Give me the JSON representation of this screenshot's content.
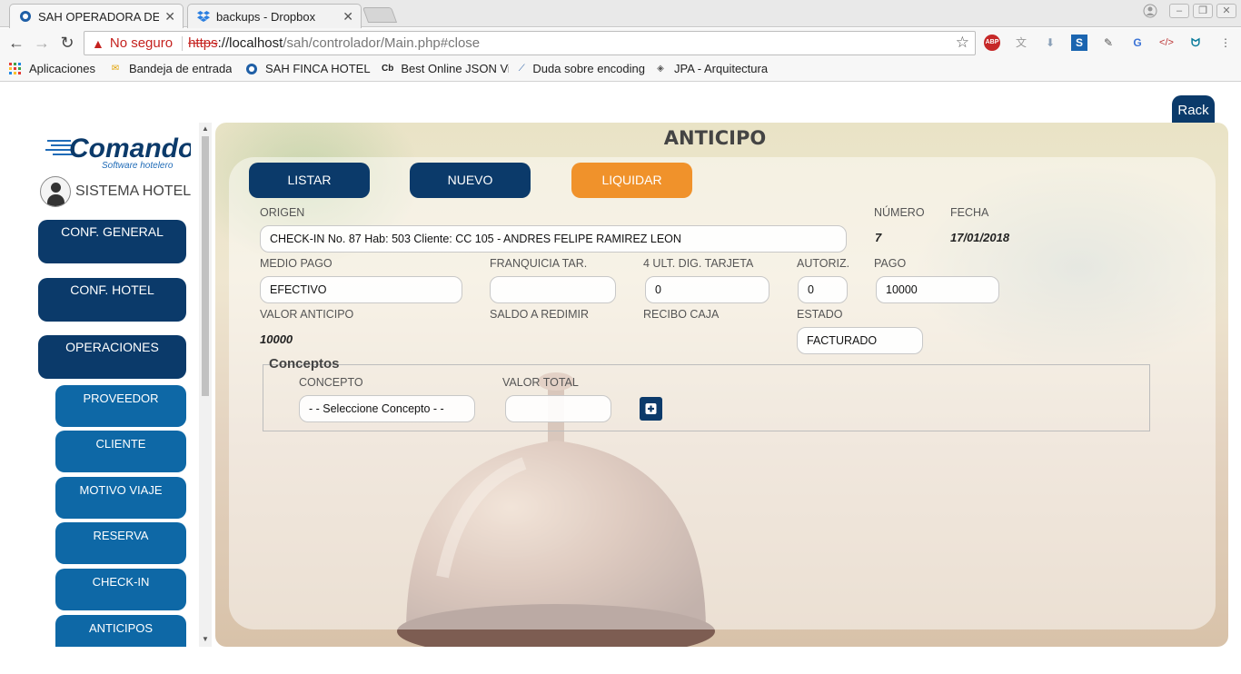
{
  "browser": {
    "tabs": [
      {
        "title": "SAH OPERADORA DE HOTELES",
        "active": true
      },
      {
        "title": "backups - Dropbox",
        "active": false
      }
    ],
    "address": {
      "security_label": "No seguro",
      "scheme": "https",
      "host": "://localhost",
      "path": "/sah/controlador/Main.php#close"
    },
    "bookmarks": [
      {
        "label": "Aplicaciones",
        "icon": "apps-grid-icon"
      },
      {
        "label": "Bandeja de entrada",
        "icon": "mail-icon"
      },
      {
        "label": "SAH FINCA HOTEL",
        "icon": "sah-icon"
      },
      {
        "label": "Best Online JSON Viewer",
        "icon": "cb-icon"
      },
      {
        "label": "Duda sobre encoding",
        "icon": "so-icon"
      },
      {
        "label": "JPA - Arquitectura",
        "icon": "diamond-icon"
      }
    ]
  },
  "page": {
    "rack_button": "Rack",
    "title": "ANTICIPO"
  },
  "sidebar": {
    "logo_text": "Comando",
    "logo_sub": "Software hotelero",
    "system_label": "SISTEMA HOTEL",
    "main_menu": [
      "CONF. GENERAL",
      "CONF. HOTEL",
      "OPERACIONES"
    ],
    "sub_menu": [
      "PROVEEDOR",
      "CLIENTE",
      "MOTIVO VIAJE",
      "RESERVA",
      "CHECK-IN",
      "ANTICIPOS"
    ]
  },
  "actions": {
    "listar": "LISTAR",
    "nuevo": "NUEVO",
    "liquidar": "LIQUIDAR"
  },
  "form": {
    "origen_label": "ORIGEN",
    "origen_value": "CHECK-IN No. 87 Hab: 503 Cliente: CC 105 - ANDRES FELIPE RAMIREZ LEON",
    "numero_label": "NÚMERO",
    "numero_value": "7",
    "fecha_label": "FECHA",
    "fecha_value": "17/01/2018",
    "medio_pago_label": "MEDIO PAGO",
    "medio_pago_value": "EFECTIVO",
    "franquicia_label": "FRANQUICIA TAR.",
    "franquicia_value": "",
    "ult_dig_label": "4 ULT. DIG. TARJETA",
    "ult_dig_value": "0",
    "autoriz_label": "AUTORIZ.",
    "autoriz_value": "0",
    "pago_label": "PAGO",
    "pago_value": "10000",
    "valor_anticipo_label": "VALOR ANTICIPO",
    "valor_anticipo_value": "10000",
    "saldo_label": "SALDO A REDIMIR",
    "recibo_label": "RECIBO CAJA",
    "estado_label": "ESTADO",
    "estado_value": "FACTURADO"
  },
  "conceptos": {
    "legend": "Conceptos",
    "concepto_label": "CONCEPTO",
    "concepto_value": "- - Seleccione Concepto - -",
    "valor_total_label": "VALOR TOTAL",
    "valor_total_value": "",
    "add_icon": "plus-square-icon"
  },
  "colors": {
    "navy": "#0b3a6a",
    "blue": "#0e68a6",
    "orange": "#f0922b"
  }
}
